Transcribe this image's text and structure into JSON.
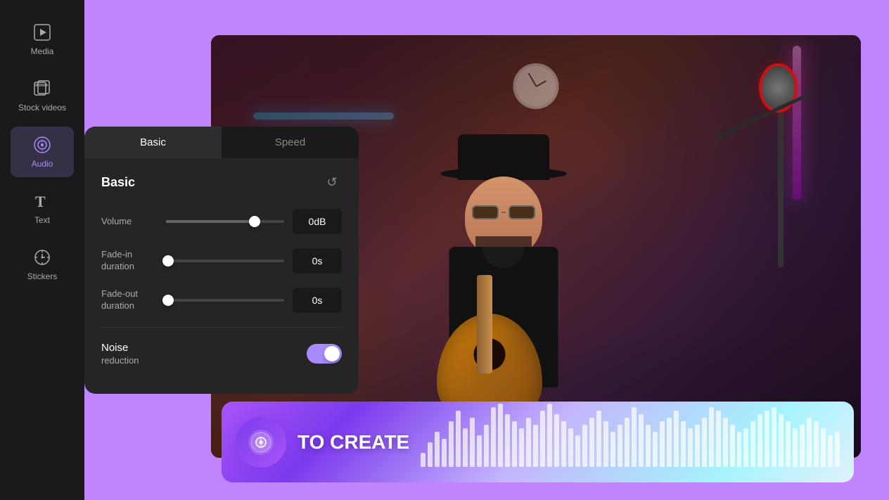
{
  "app": {
    "background_color": "#c084fc"
  },
  "sidebar": {
    "items": [
      {
        "id": "media",
        "label": "Media",
        "icon": "▶",
        "active": false
      },
      {
        "id": "stock-videos",
        "label": "Stock videos",
        "icon": "⊞",
        "active": false
      },
      {
        "id": "audio",
        "label": "Audio",
        "icon": "♪",
        "active": true
      },
      {
        "id": "text",
        "label": "Text",
        "icon": "T",
        "active": false
      },
      {
        "id": "stickers",
        "label": "Stickers",
        "icon": "⏱",
        "active": false
      }
    ]
  },
  "audio_panel": {
    "tabs": [
      {
        "id": "basic",
        "label": "Basic",
        "active": true
      },
      {
        "id": "speed",
        "label": "Speed",
        "active": false
      }
    ],
    "section_title": "Basic",
    "reset_tooltip": "Reset",
    "controls": {
      "volume": {
        "label": "Volume",
        "value": "0dB",
        "fill_percent": 75
      },
      "fade_in": {
        "label": "Fade-in duration",
        "value": "0s",
        "fill_percent": 0
      },
      "fade_out": {
        "label": "Fade-out duration",
        "value": "0s",
        "fill_percent": 0
      }
    },
    "noise_reduction": {
      "label": "Noise",
      "sub_label": "reduction",
      "enabled": true
    }
  },
  "audio_banner": {
    "text": "TO CREATE",
    "waveform_bars": [
      20,
      35,
      50,
      40,
      65,
      80,
      55,
      70,
      45,
      60,
      85,
      90,
      75,
      65,
      55,
      70,
      60,
      80,
      90,
      75,
      65,
      55,
      45,
      60,
      70,
      80,
      65,
      50,
      60,
      70,
      85,
      75,
      60,
      50,
      65,
      70,
      80,
      65,
      55,
      60,
      70,
      85,
      80,
      70,
      60,
      50,
      55,
      65,
      75,
      80,
      85,
      75,
      65,
      55,
      60,
      70,
      65,
      55,
      45,
      50
    ]
  }
}
